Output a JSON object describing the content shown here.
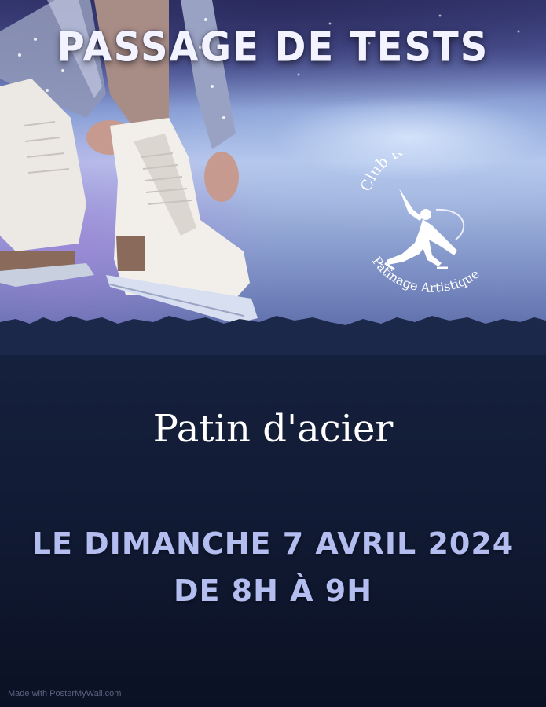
{
  "poster": {
    "title": "PASSAGE DE TESTS",
    "logo": {
      "top_text": "Club Roannais",
      "bottom_text": "Patinage Artistique",
      "icon": "figure-skater-icon"
    },
    "subtitle": "Patin d'acier",
    "date_line_1": "LE DIMANCHE 7 AVRIL 2024",
    "date_line_2": "DE 8H À 9H",
    "credit": "Made with PosterMyWall.com"
  },
  "colors": {
    "background_dark": "#111a33",
    "date_text": "#b4bdf0",
    "title_text": "#f3f2ff"
  }
}
